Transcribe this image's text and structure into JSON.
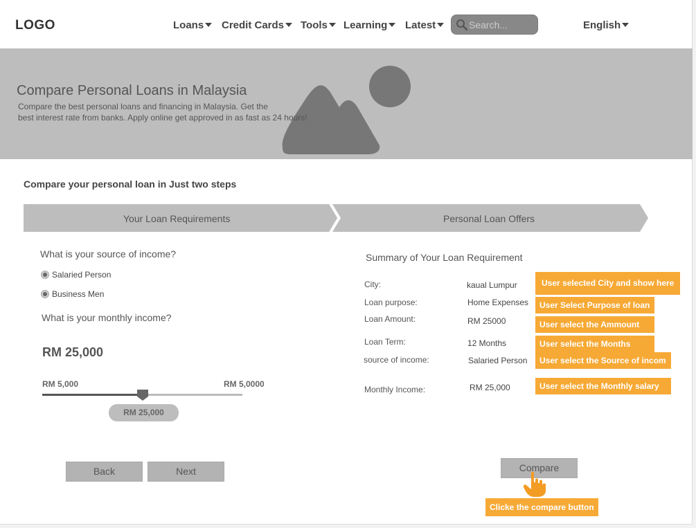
{
  "header": {
    "logo": "LOGO",
    "nav": [
      {
        "label": "Loans"
      },
      {
        "label": "Credit Cards"
      },
      {
        "label": "Tools"
      },
      {
        "label": "Learning"
      },
      {
        "label": "Latest"
      }
    ],
    "search_placeholder": "Search...",
    "language": "English"
  },
  "hero": {
    "title": "Compare Personal Loans in Malaysia",
    "subtitle_line1": "Compare the best personal loans and financing in Malaysia. Get the",
    "subtitle_line2": "best interest rate from banks. Apply online get approved in as fast as 24 hours!"
  },
  "steps": {
    "title": "Compare your personal loan in Just two steps",
    "step1": "Your Loan Requirements",
    "step2": "Personal Loan Offers"
  },
  "form": {
    "income_source_question": "What is your source of income?",
    "options": [
      "Salaried Person",
      "Business Men"
    ],
    "monthly_income_question": "What is your monthly income?",
    "amount_display": "RM 25,000",
    "range_min": "RM 5,000",
    "range_max": "RM 5,0000",
    "slider_value_label": "RM 25,000",
    "slider_level": 0.5,
    "back_label": "Back",
    "next_label": "Next"
  },
  "summary": {
    "title": "Summary of Your Loan Requirement",
    "rows": [
      {
        "key": "City:",
        "value": "kaual Lumpur",
        "note": "User selected City and show here"
      },
      {
        "key": "Loan purpose:",
        "value": "Home Expenses",
        "note": "User Select Purpose of loan"
      },
      {
        "key": "Loan Amount:",
        "value": "RM 25000",
        "note": "User select the Ammount"
      },
      {
        "key": "Loan Term:",
        "value": "12 Months",
        "note": "User select the Months"
      },
      {
        "key": "source of income:",
        "value": "Salaried Person",
        "note": "User select the Source of incom"
      },
      {
        "key": "Monthly Income:",
        "value": "RM 25,000",
        "note": "User select the Monthly salary"
      }
    ],
    "compare_label": "Compare",
    "compare_note": "Clicke the compare button"
  },
  "colors": {
    "note_orange": "#f7a935",
    "hero_gray": "#bdbdbd",
    "button_gray": "#b3b3b3"
  }
}
